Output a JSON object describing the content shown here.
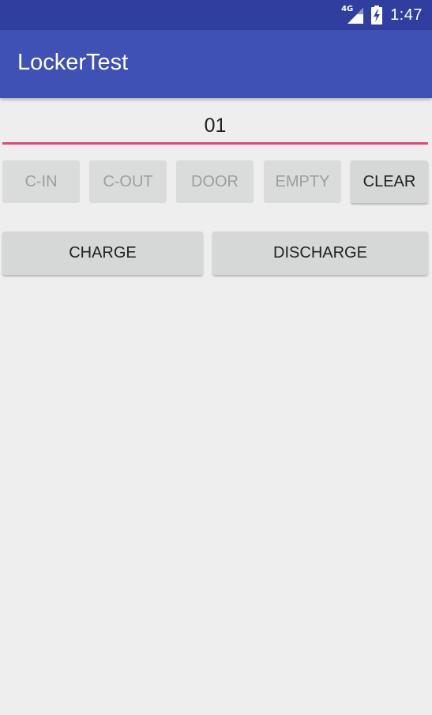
{
  "status_bar": {
    "network_label": "4G",
    "network_icon": "signal-icon",
    "battery_icon": "battery-charging-icon",
    "time": "1:47",
    "background_color": "#303f9f"
  },
  "app_bar": {
    "title": "LockerTest",
    "background_color": "#3f51b5"
  },
  "locker_number": {
    "value": "01",
    "underline_color": "#e8457a"
  },
  "command_buttons": {
    "c_in": "C-IN",
    "c_out": "C-OUT",
    "door": "DOOR",
    "empty": "EMPTY",
    "clear": "CLEAR"
  },
  "actions": {
    "charge": "CHARGE",
    "discharge": "DISCHARGE"
  }
}
